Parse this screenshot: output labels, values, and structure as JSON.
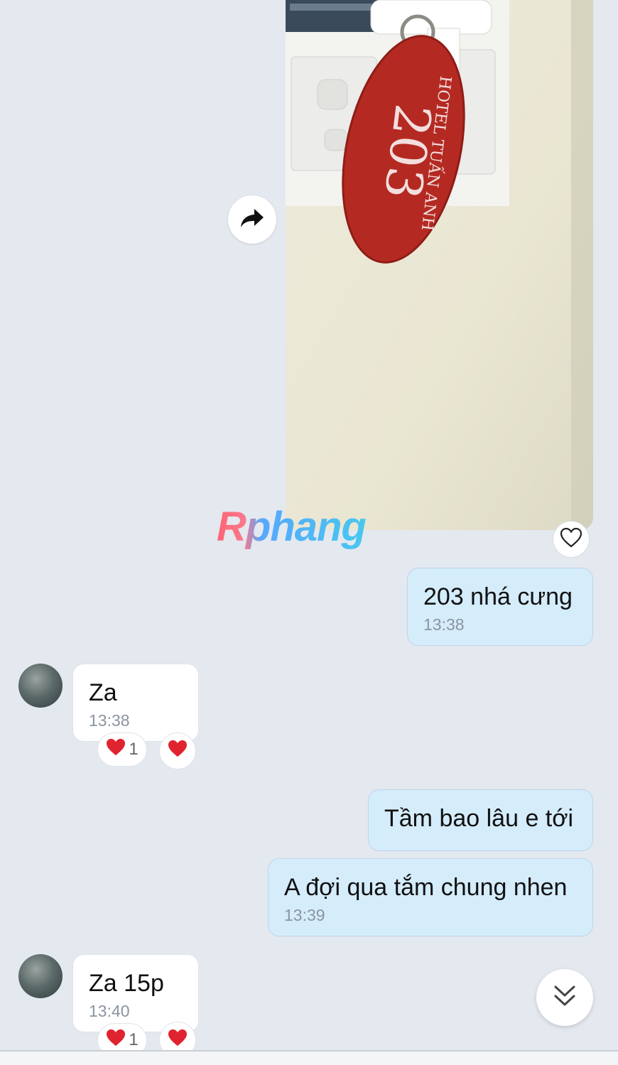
{
  "photo": {
    "tag_hotel_text": "HOTEL TUẤN ANH",
    "tag_room_number": "203"
  },
  "watermark": {
    "text": "Rphang"
  },
  "messages": {
    "m1": {
      "text": "203 nhá cưng",
      "time": "13:38"
    },
    "m2": {
      "text": "Za",
      "time": "13:38"
    },
    "m3": {
      "text": "Tầm bao lâu e tới"
    },
    "m4": {
      "text": "A đợi qua tắm chung nhen",
      "time": "13:39"
    },
    "m5": {
      "text": "Za 15p",
      "time": "13:40"
    }
  },
  "reactions": {
    "r1_count": "1",
    "r2_count": "1"
  },
  "icons": {
    "forward": "forward-arrow-icon",
    "like": "heart-outline-icon",
    "reaction": "red-heart-icon",
    "scroll": "double-chevron-down-icon"
  },
  "colors": {
    "background": "#e4e8ef",
    "outgoing_bubble": "#d5ecfb",
    "incoming_bubble": "#ffffff",
    "heart": "#e0242f"
  }
}
